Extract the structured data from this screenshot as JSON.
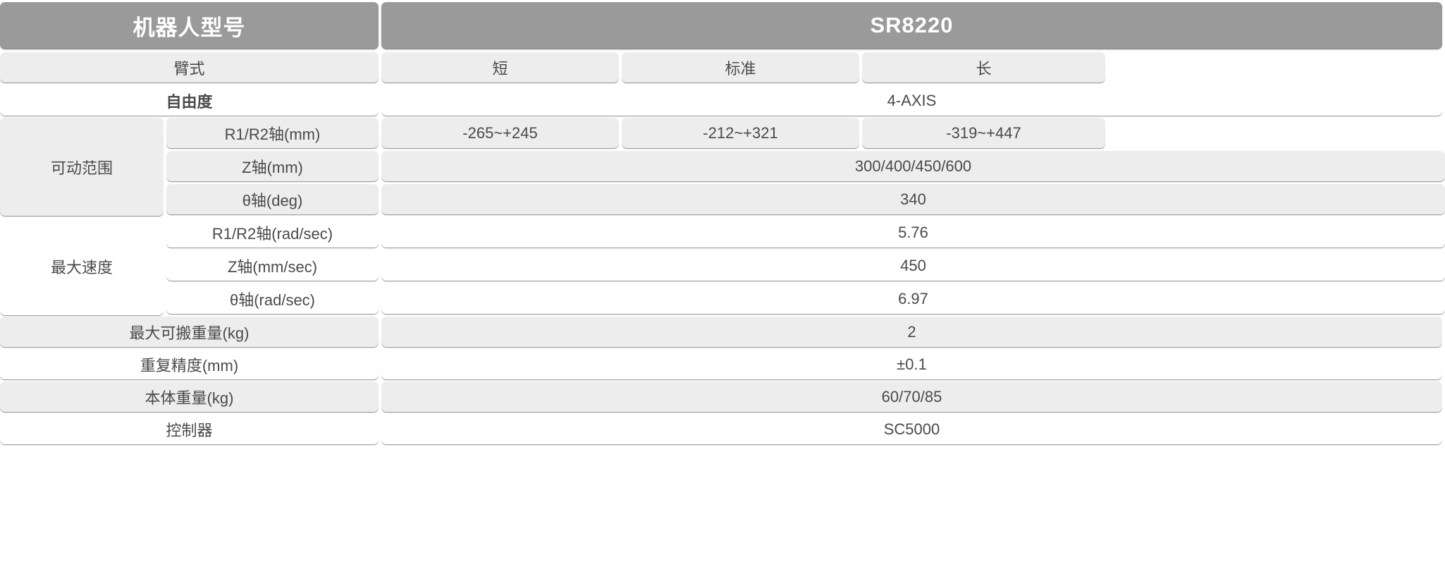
{
  "table": {
    "header": {
      "label": "机器人型号",
      "model": "SR8220"
    },
    "arm_type": {
      "label": "臂式",
      "options": [
        "短",
        "标准",
        "长"
      ]
    },
    "dof": {
      "label": "自由度",
      "value": "4-AXIS"
    },
    "motion_range": {
      "label": "可动范围",
      "rows": [
        {
          "label": "R1/R2轴(mm)",
          "split": true,
          "values": [
            "-265~+245",
            "-212~+321",
            "-319~+447"
          ]
        },
        {
          "label": "Z轴(mm)",
          "split": false,
          "value": "300/400/450/600"
        },
        {
          "label": "θ轴(deg)",
          "split": false,
          "value": "340"
        }
      ]
    },
    "max_speed": {
      "label": "最大速度",
      "rows": [
        {
          "label": "R1/R2轴(rad/sec)",
          "split": false,
          "value": "5.76"
        },
        {
          "label": "Z轴(mm/sec)",
          "split": false,
          "value": "450"
        },
        {
          "label": "θ轴(rad/sec)",
          "split": false,
          "value": "6.97"
        }
      ]
    },
    "payload": {
      "label": "最大可搬重量(kg)",
      "value": "2"
    },
    "repeatability": {
      "label": "重复精度(mm)",
      "value": "±0.1"
    },
    "body_weight": {
      "label": "本体重量(kg)",
      "value": "60/70/85"
    },
    "controller": {
      "label": "控制器",
      "value": "SC5000"
    }
  },
  "colors": {
    "header_bg": "#9a9a9a",
    "header_text": "#ffffff",
    "tint_gray": "#ededed",
    "tint_white": "#ffffff",
    "body_text": "#4a4a4a"
  }
}
